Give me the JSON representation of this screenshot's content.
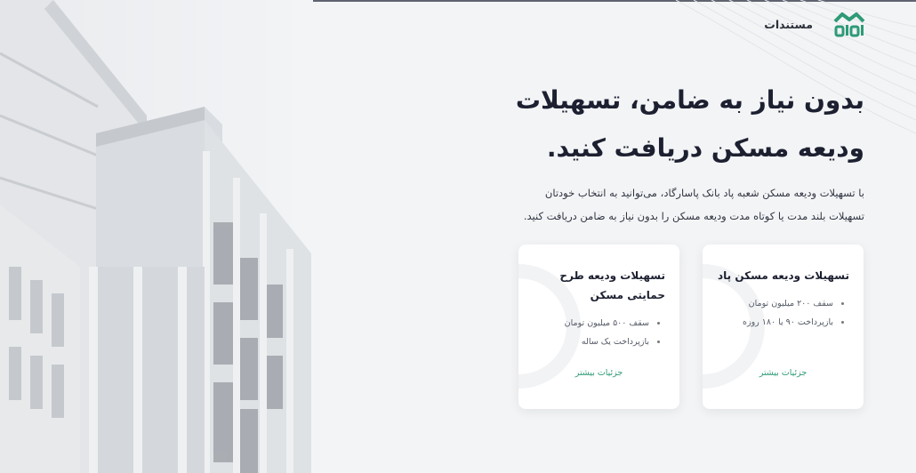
{
  "header": {
    "logo_text": "ماوا",
    "nav_docs": "مستندات"
  },
  "hero": {
    "title_line1": "بدون نیاز به ضامن، تسهیلات",
    "title_line2": "ودیعه مسکن دریافت کنید.",
    "subtitle_line1": "با تسهیلات ودیعه مسکن شعبه پاد بانک پاسارگاد، می‌توانید به انتخاب خودتان",
    "subtitle_line2": "تسهیلات بلند مدت یا کوتاه مدت ودیعه مسکن را بدون نیاز به ضامن دریافت کنید."
  },
  "cards": [
    {
      "title": "تسهیلات ودیعه مسکن پاد",
      "items": [
        "سقف ۲۰۰ میلیون تومان",
        "بازپرداخت ۹۰ یا ۱۸۰ روزه"
      ],
      "more": "جزئیات بیشتر"
    },
    {
      "title": "تسهیلات ودیعه طرح حمایتی مسکن",
      "items": [
        "سقف ۵۰۰ میلیون تومان",
        "بازپرداخت یک ساله"
      ],
      "more": "جزئیات بیشتر"
    }
  ],
  "colors": {
    "accent": "#2e9a76",
    "logo": "#2e9a76",
    "background": "#f3f4f6"
  }
}
